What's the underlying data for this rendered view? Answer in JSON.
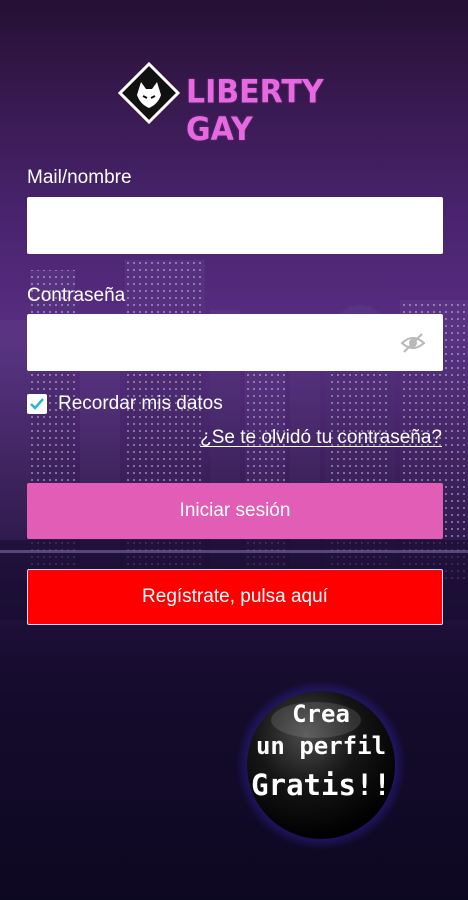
{
  "brand": {
    "name": "LIBERTY GAY",
    "accent": "#e56ae0"
  },
  "login_form": {
    "username_label": "Mail/nombre",
    "username_value": "",
    "password_label": "Contraseña",
    "password_value": "",
    "password_toggle_icon": "eye-off-icon",
    "remember_label": "Recordar mis datos",
    "remember_checked": true,
    "forgot_link": "¿Se te olvidó tu contraseña?",
    "login_button": "Iniciar sesión",
    "register_button": "Regístrate, pulsa aquí"
  },
  "promo_badge": {
    "line1": "Crea",
    "line2": "un perfil",
    "line3": "Gratis!!"
  },
  "colors": {
    "login_button": "#e25db5",
    "register_button": "#ff0000",
    "checkbox": "#2bb3d9"
  }
}
